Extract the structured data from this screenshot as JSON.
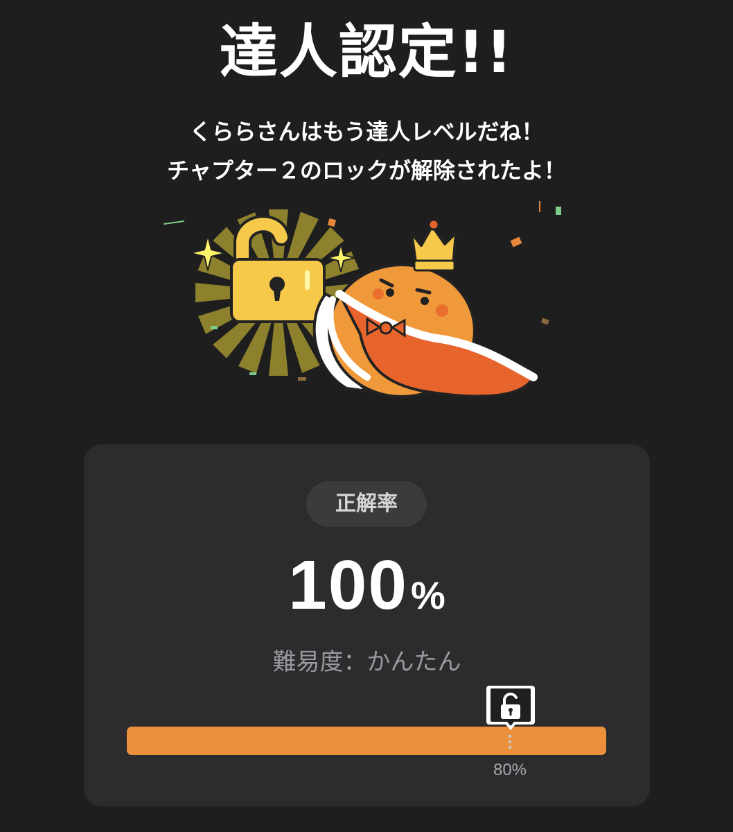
{
  "header": {
    "title": "達人認定!!",
    "message_lines": [
      "くららさんはもう達人レベルだね！",
      "チャプター２のロックが解除されたよ！"
    ]
  },
  "illustration": {
    "icons": [
      "unlocked-padlock-icon",
      "crowned-mascot",
      "sparkle-icon",
      "confetti"
    ]
  },
  "result_card": {
    "label": "正解率",
    "accuracy_value": "100",
    "accuracy_unit": "%",
    "accuracy_percent": 100,
    "difficulty": "難易度：かんたん",
    "threshold_label": "80%",
    "threshold_percent": 80,
    "threshold_icon": "unlocked-padlock-icon"
  },
  "colors": {
    "background": "#1e1e1f",
    "card": "#2c2c2e",
    "accent_orange": "#ec903b",
    "lock_gold": "#f6c94a",
    "mascot_orange": "#f0993a",
    "cape_orange": "#e8642d"
  }
}
